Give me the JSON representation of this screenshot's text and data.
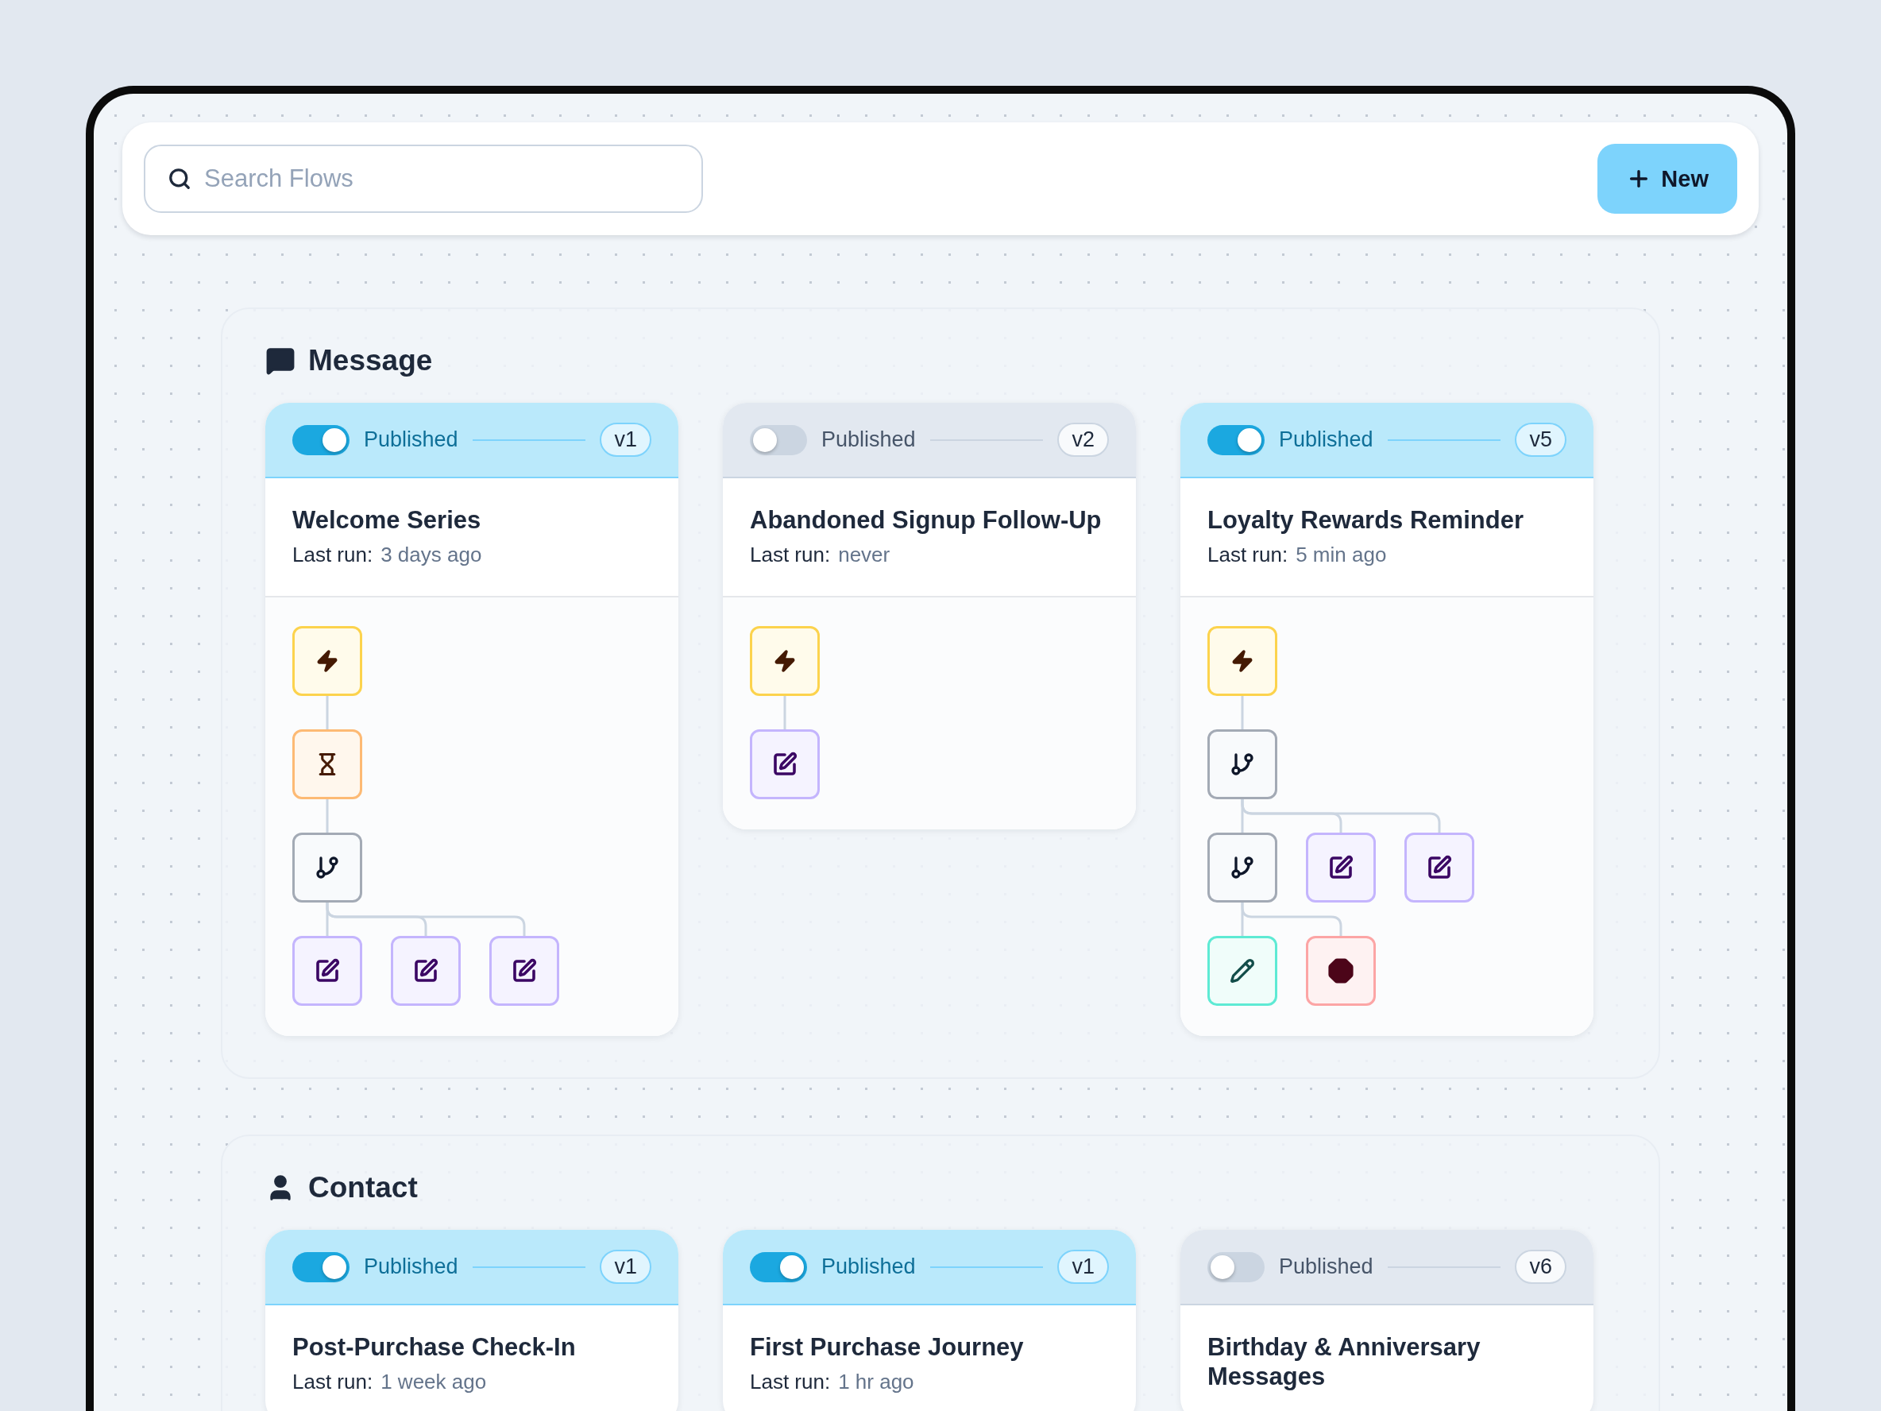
{
  "search": {
    "placeholder": "Search Flows"
  },
  "new_button": {
    "label": "New"
  },
  "sections": [
    {
      "kind": "message",
      "title": "Message",
      "flows": [
        {
          "published": true,
          "status": "Published",
          "version": "v1",
          "name": "Welcome Series",
          "last_run_label": "Last run:",
          "last_run": "3 days ago",
          "tree": {
            "kind": "trigger",
            "children": [
              {
                "kind": "wait",
                "children": [
                  {
                    "kind": "branch",
                    "children": [
                      {
                        "kind": "edit"
                      },
                      {
                        "kind": "edit"
                      },
                      {
                        "kind": "edit"
                      }
                    ]
                  }
                ]
              }
            ]
          }
        },
        {
          "published": false,
          "status": "Published",
          "version": "v2",
          "name": "Abandoned Signup Follow-Up",
          "last_run_label": "Last run:",
          "last_run": "never",
          "tree": {
            "kind": "trigger",
            "children": [
              {
                "kind": "edit"
              }
            ]
          }
        },
        {
          "published": true,
          "status": "Published",
          "version": "v5",
          "name": "Loyalty Rewards Reminder",
          "last_run_label": "Last run:",
          "last_run": "5 min ago",
          "tree": {
            "kind": "trigger",
            "children": [
              {
                "kind": "branch",
                "children": [
                  {
                    "kind": "branch",
                    "children": [
                      {
                        "kind": "action"
                      },
                      {
                        "kind": "stop"
                      }
                    ]
                  },
                  {
                    "kind": "edit"
                  },
                  {
                    "kind": "edit"
                  }
                ]
              }
            ]
          }
        }
      ]
    },
    {
      "kind": "contact",
      "title": "Contact",
      "flows": [
        {
          "published": true,
          "status": "Published",
          "version": "v1",
          "name": "Post-Purchase Check-In",
          "last_run_label": "Last run:",
          "last_run": "1 week ago"
        },
        {
          "published": true,
          "status": "Published",
          "version": "v1",
          "name": "First Purchase Journey",
          "last_run_label": "Last run:",
          "last_run": "1 hr ago"
        },
        {
          "published": false,
          "status": "Published",
          "version": "v6",
          "name": "Birthday & Anniversary Messages"
        }
      ]
    }
  ]
}
